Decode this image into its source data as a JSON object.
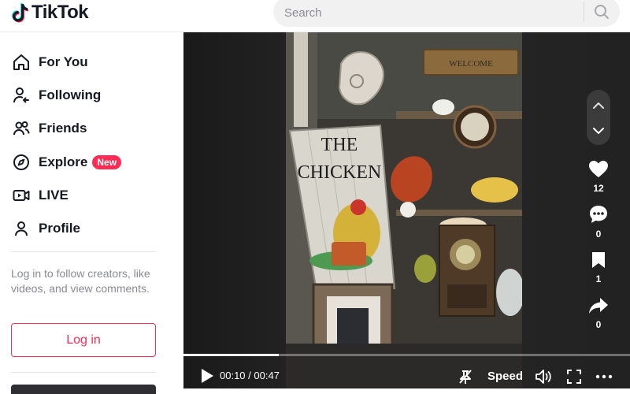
{
  "header": {
    "logo_text": "TikTok",
    "search": {
      "placeholder": "Search"
    }
  },
  "sidebar": {
    "nav": [
      {
        "label": "For You",
        "icon": "home-icon"
      },
      {
        "label": "Following",
        "icon": "user-follow-icon"
      },
      {
        "label": "Friends",
        "icon": "friends-icon"
      },
      {
        "label": "Explore",
        "icon": "compass-icon",
        "badge": "New"
      },
      {
        "label": "LIVE",
        "icon": "live-icon"
      },
      {
        "label": "Profile",
        "icon": "profile-icon"
      }
    ],
    "login_prompt": "Log in to follow creators, like videos, and view comments.",
    "login_button": "Log in"
  },
  "player": {
    "time": "00:10 / 00:47",
    "progress": 0.2128,
    "speed_label": "Speed",
    "sign_text_1": "THE",
    "sign_text_2": "CHICKEN",
    "welcome_sign": "WELCOME",
    "actions": {
      "likes": "12",
      "comments": "0",
      "saves": "1",
      "shares": "0"
    }
  },
  "colors": {
    "accent": "#fe2c55",
    "text": "#161823",
    "muted": "#8a8b91"
  }
}
